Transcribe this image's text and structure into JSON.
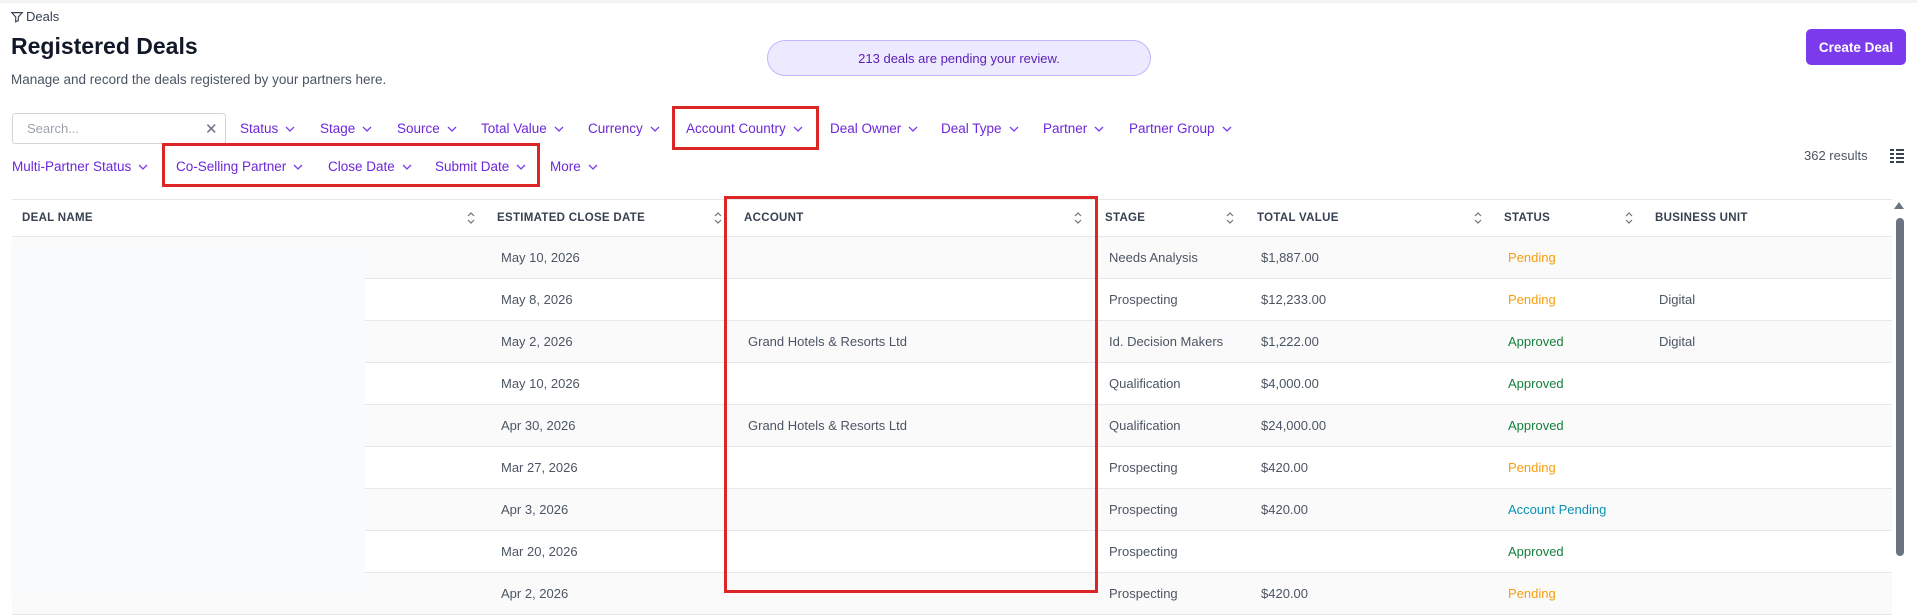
{
  "breadcrumb": {
    "label": "Deals"
  },
  "header": {
    "title": "Registered Deals",
    "subtitle": "Manage and record the deals registered by your partners here.",
    "pending_banner": "213 deals are pending your review.",
    "create_button": "Create Deal"
  },
  "search": {
    "placeholder": "Search...",
    "value": ""
  },
  "filters": {
    "status": "Status",
    "stage": "Stage",
    "source": "Source",
    "total_value": "Total Value",
    "currency": "Currency",
    "account_country": "Account Country",
    "deal_owner": "Deal Owner",
    "deal_type": "Deal Type",
    "partner": "Partner",
    "partner_group": "Partner Group",
    "multi_partner_status": "Multi-Partner Status",
    "co_selling_partner": "Co-Selling Partner",
    "close_date": "Close Date",
    "submit_date": "Submit Date",
    "more": "More"
  },
  "results": "362 results",
  "table": {
    "columns": {
      "deal_name": "DEAL NAME",
      "close_date": "ESTIMATED CLOSE DATE",
      "account": "ACCOUNT",
      "stage": "STAGE",
      "total_value": "TOTAL VALUE",
      "status": "STATUS",
      "business_unit": "BUSINESS UNIT"
    },
    "rows": [
      {
        "close_date": "May 10, 2026",
        "account": "",
        "stage": "Needs Analysis",
        "total_value": "$1,887.00",
        "status": "Pending",
        "business_unit": ""
      },
      {
        "close_date": "May 8, 2026",
        "account": "",
        "stage": "Prospecting",
        "total_value": "$12,233.00",
        "status": "Pending",
        "business_unit": "Digital"
      },
      {
        "close_date": "May 2, 2026",
        "account": "Grand Hotels & Resorts Ltd",
        "stage": "Id. Decision Makers",
        "total_value": "$1,222.00",
        "status": "Approved",
        "business_unit": "Digital"
      },
      {
        "close_date": "May 10, 2026",
        "account": "",
        "stage": "Qualification",
        "total_value": "$4,000.00",
        "status": "Approved",
        "business_unit": ""
      },
      {
        "close_date": "Apr 30, 2026",
        "account": "Grand Hotels & Resorts Ltd",
        "stage": "Qualification",
        "total_value": "$24,000.00",
        "status": "Approved",
        "business_unit": ""
      },
      {
        "close_date": "Mar 27, 2026",
        "account": "",
        "stage": "Prospecting",
        "total_value": "$420.00",
        "status": "Pending",
        "business_unit": ""
      },
      {
        "close_date": "Apr 3, 2026",
        "account": "",
        "stage": "Prospecting",
        "total_value": "$420.00",
        "status": "Account Pending",
        "business_unit": ""
      },
      {
        "close_date": "Mar 20, 2026",
        "account": "",
        "stage": "Prospecting",
        "total_value": "",
        "status": "Approved",
        "business_unit": ""
      },
      {
        "close_date": "Apr 2, 2026",
        "account": "",
        "stage": "Prospecting",
        "total_value": "$420.00",
        "status": "Pending",
        "business_unit": ""
      }
    ]
  },
  "status_colors": {
    "Pending": "#f59e0b",
    "Approved": "#15803d",
    "Account Pending": "#0891b2"
  },
  "colors": {
    "accent": "#7c3aed",
    "highlight": "#dc2626"
  }
}
